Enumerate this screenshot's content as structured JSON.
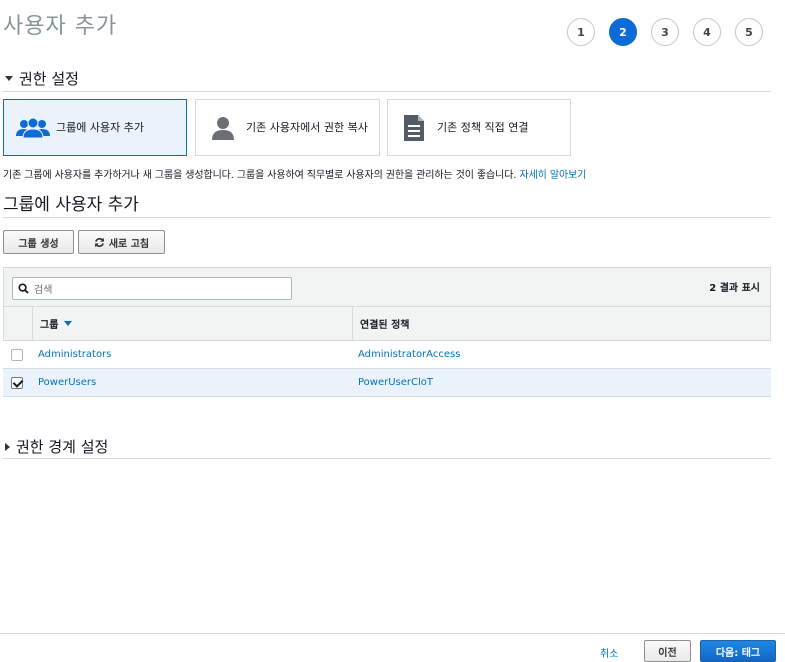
{
  "page": {
    "title": "사용자 추가"
  },
  "steps": [
    "1",
    "2",
    "3",
    "4",
    "5"
  ],
  "active_step": "2",
  "permissions": {
    "heading": "권한 설정",
    "options": [
      {
        "label": "그룹에 사용자 추가",
        "icon": "users-group-icon",
        "selected": true
      },
      {
        "label": "기존 사용자에서 권한 복사",
        "icon": "user-icon",
        "selected": false
      },
      {
        "label": "기존 정책 직접 연결",
        "icon": "document-icon",
        "selected": false
      }
    ],
    "info_text": "기존 그룹에 사용자를 추가하거나 새 그룹을 생성합니다. 그룹을 사용하여 직무별로 사용자의 권한을 관리하는 것이 좋습니다.",
    "info_link": "자세히 알아보기"
  },
  "group_section": {
    "title": "그룹에 사용자 추가",
    "create_group_label": "그룹 생성",
    "refresh_label": "새로 고침",
    "search_placeholder": "검색",
    "result_count": "2 결과 표시",
    "columns": {
      "group": "그룹",
      "policy": "연결된 정책"
    },
    "rows": [
      {
        "group": "Administrators",
        "policy": "AdministratorAccess",
        "checked": false
      },
      {
        "group": "PowerUsers",
        "policy": "PowerUserCloT",
        "checked": true
      }
    ]
  },
  "boundary": {
    "heading": "권한 경계 설정"
  },
  "footer": {
    "cancel": "취소",
    "previous": "이전",
    "next": "다음: 태그"
  },
  "colors": {
    "accent": "#0d6bd7",
    "link": "#0073bb",
    "selected_bg": "#eaf3fb"
  }
}
